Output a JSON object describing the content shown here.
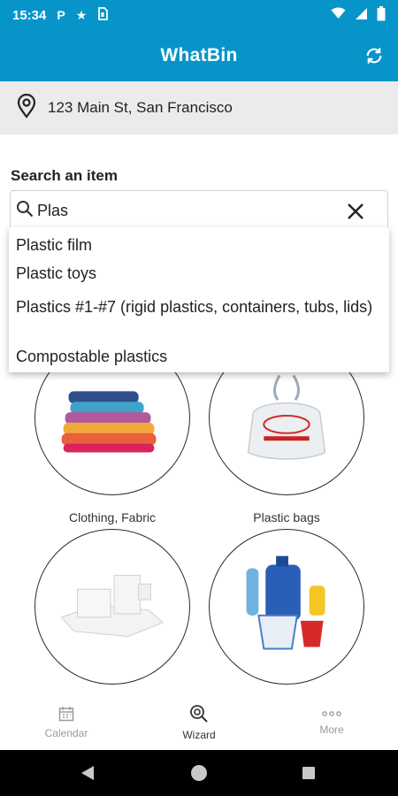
{
  "status_bar": {
    "time": "15:34",
    "left_icons": [
      "parking-icon",
      "star-icon",
      "sim-card-icon"
    ],
    "right_icons": [
      "wifi-icon",
      "signal-icon",
      "battery-icon"
    ]
  },
  "app_bar": {
    "title": "WhatBin",
    "refresh_icon": "refresh-icon"
  },
  "location": {
    "icon": "location-pin-icon",
    "address": "123 Main St, San Francisco"
  },
  "search": {
    "heading": "Search an item",
    "value": "Plas",
    "icon": "search-icon",
    "clear_icon": "close-icon"
  },
  "suggestions": [
    "Plastic film",
    "Plastic toys",
    "Plastics #1-#7 (rigid plastics, containers, tubs, lids)",
    "Compostable plastics"
  ],
  "categories": [
    {
      "label": "Clothing, Fabric",
      "image": "folded-clothes"
    },
    {
      "label": "Plastic bags",
      "image": "plastic-bag"
    },
    {
      "label": "",
      "image": "styrofoam"
    },
    {
      "label": "",
      "image": "plastic-containers"
    }
  ],
  "bottom_nav": [
    {
      "label": "Calendar",
      "icon": "calendar-icon",
      "active": false
    },
    {
      "label": "Wizard",
      "icon": "wizard-search-icon",
      "active": true
    },
    {
      "label": "More",
      "icon": "more-dots-icon",
      "active": false
    }
  ],
  "colors": {
    "primary": "#0795c9",
    "address_bg": "#ebebeb",
    "nav_active": "#333333",
    "nav_inactive": "#9a9a9a"
  }
}
